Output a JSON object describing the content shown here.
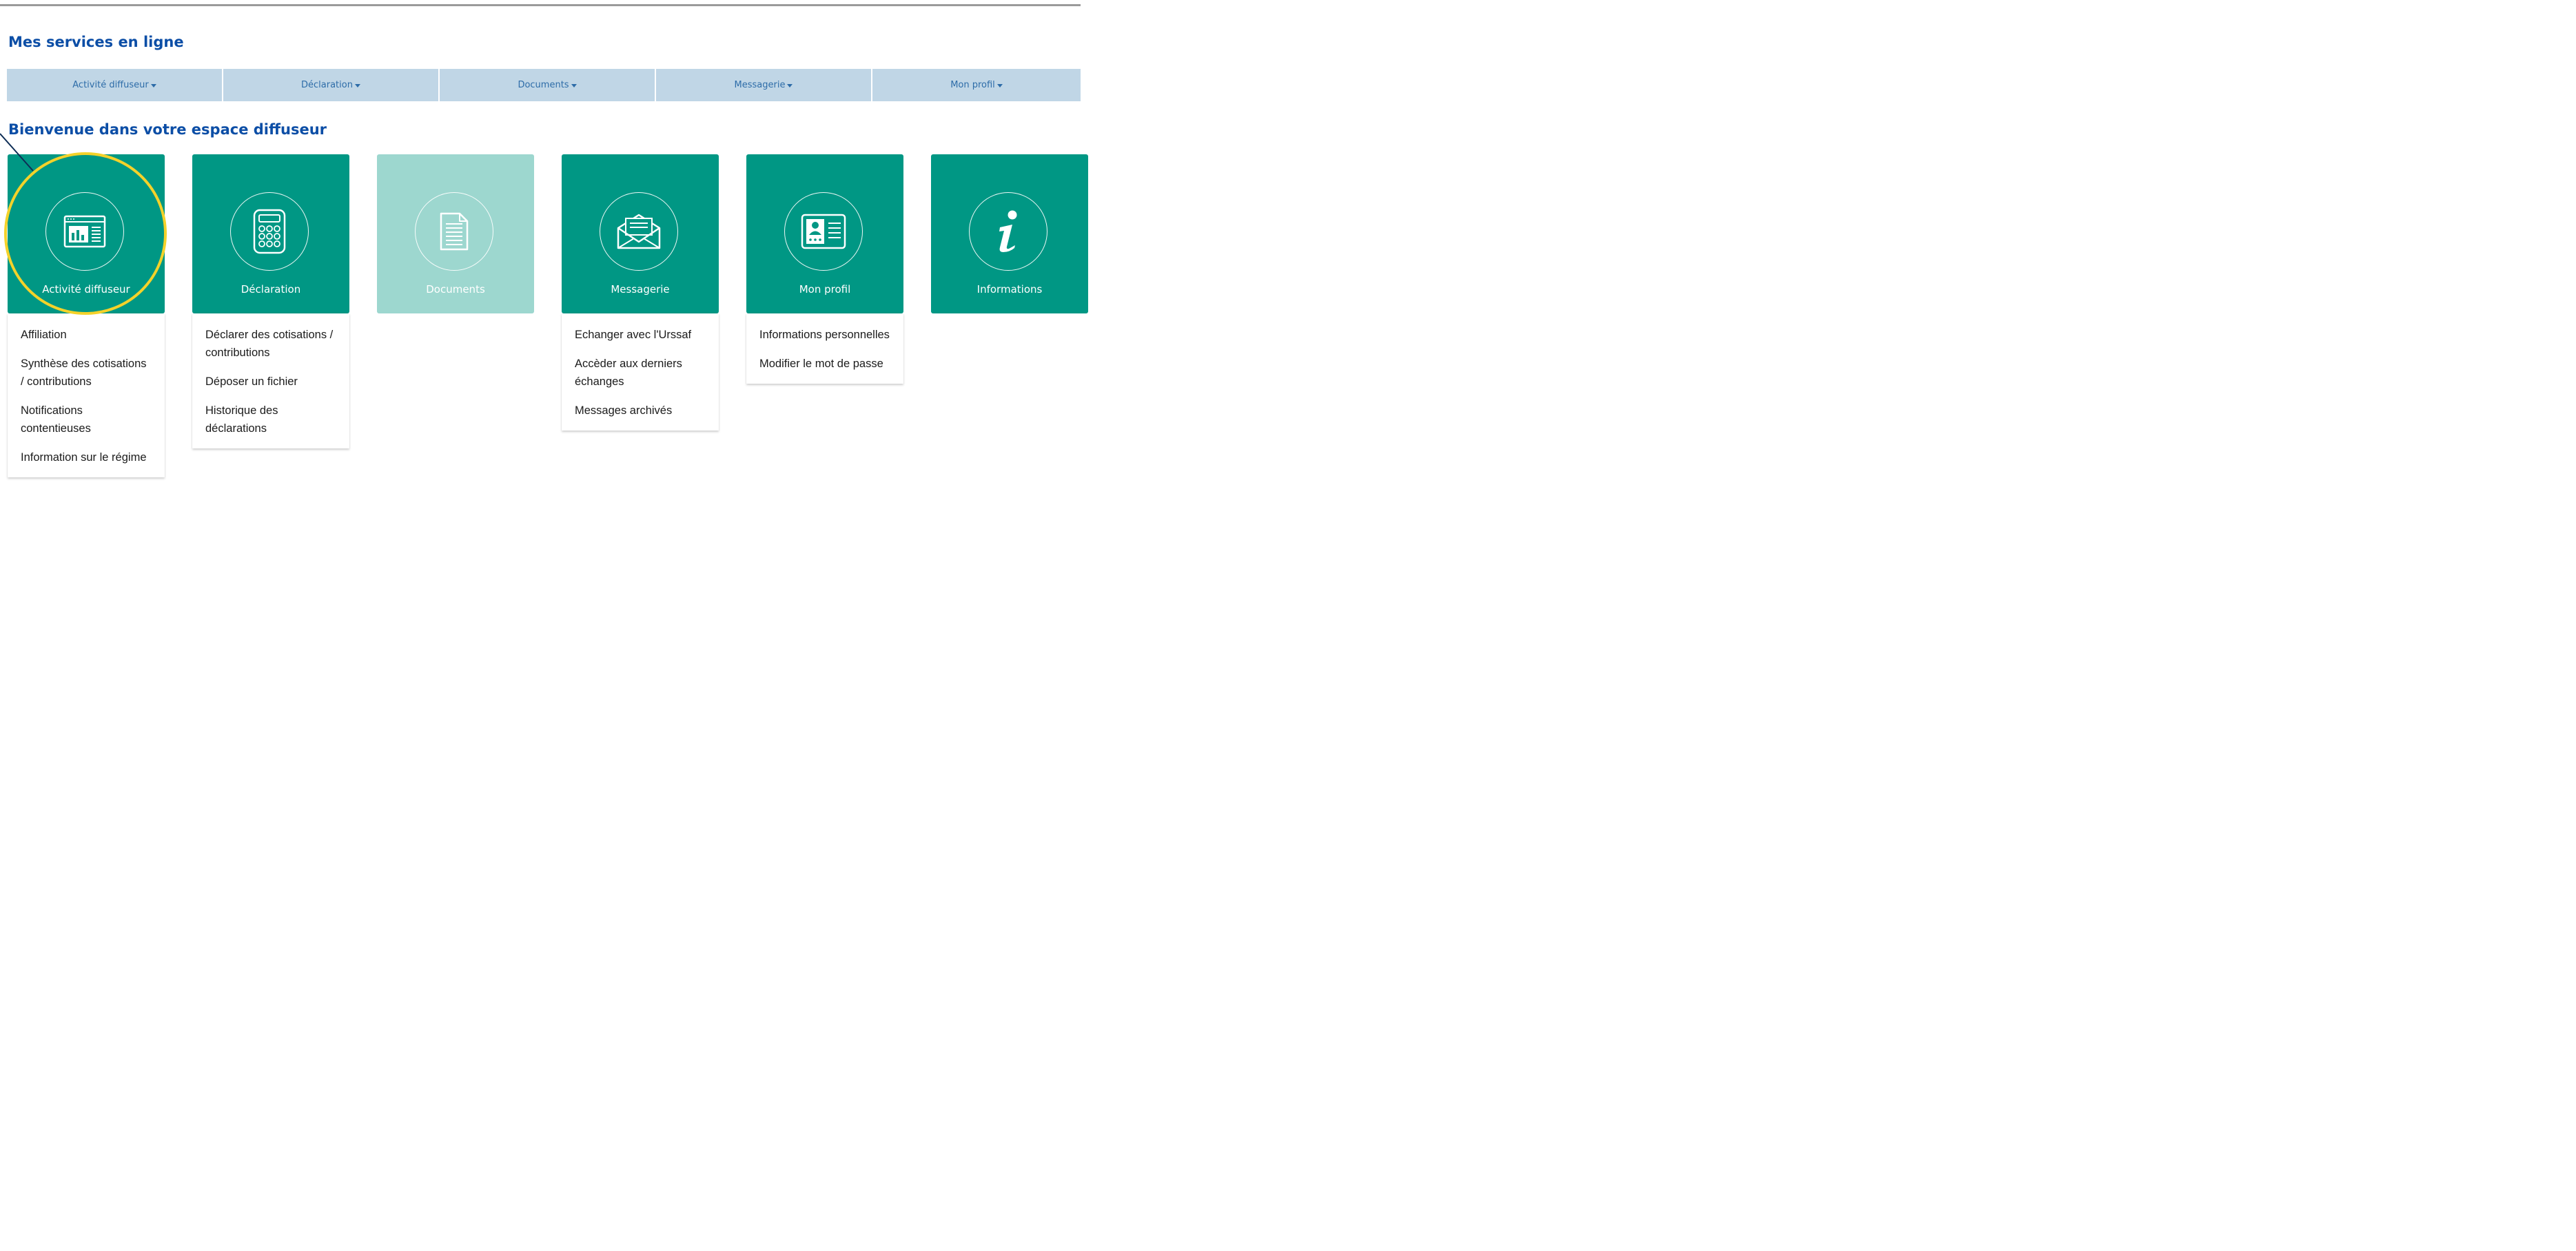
{
  "page": {
    "title": "Mes services en ligne",
    "welcome": "Bienvenue dans votre espace diffuseur"
  },
  "nav": [
    {
      "label": "Activité diffuseur"
    },
    {
      "label": "Déclaration"
    },
    {
      "label": "Documents"
    },
    {
      "label": "Messagerie"
    },
    {
      "label": "Mon profil"
    }
  ],
  "tiles": [
    {
      "label": "Activité diffuseur",
      "icon": "dashboard-chart-icon",
      "links": [
        "Affiliation",
        "Synthèse des cotisations / contributions",
        "Notifications contentieuses",
        "Information sur le régime"
      ]
    },
    {
      "label": "Déclaration",
      "icon": "calculator-icon",
      "links": [
        "Déclarer des cotisations / contributions",
        "Déposer un fichier",
        "Historique des déclarations"
      ]
    },
    {
      "label": "Documents",
      "icon": "document-icon",
      "disabled": true,
      "links": []
    },
    {
      "label": "Messagerie",
      "icon": "envelope-icon",
      "links": [
        "Echanger avec l'Urssaf",
        "Accèder aux derniers échanges",
        "Messages archivés"
      ]
    },
    {
      "label": "Mon profil",
      "icon": "profile-card-icon",
      "links": [
        "Informations personnelles",
        "Modifier le mot de passe"
      ]
    },
    {
      "label": "Informations",
      "icon": "info-icon",
      "links": []
    }
  ],
  "colors": {
    "heading": "#0c4ea6",
    "nav_bg": "#c0d6e6",
    "nav_text": "#2d6ca8",
    "tile": "#009784",
    "tile_disabled": "#9dd7cf",
    "highlight": "#f4d22a"
  }
}
